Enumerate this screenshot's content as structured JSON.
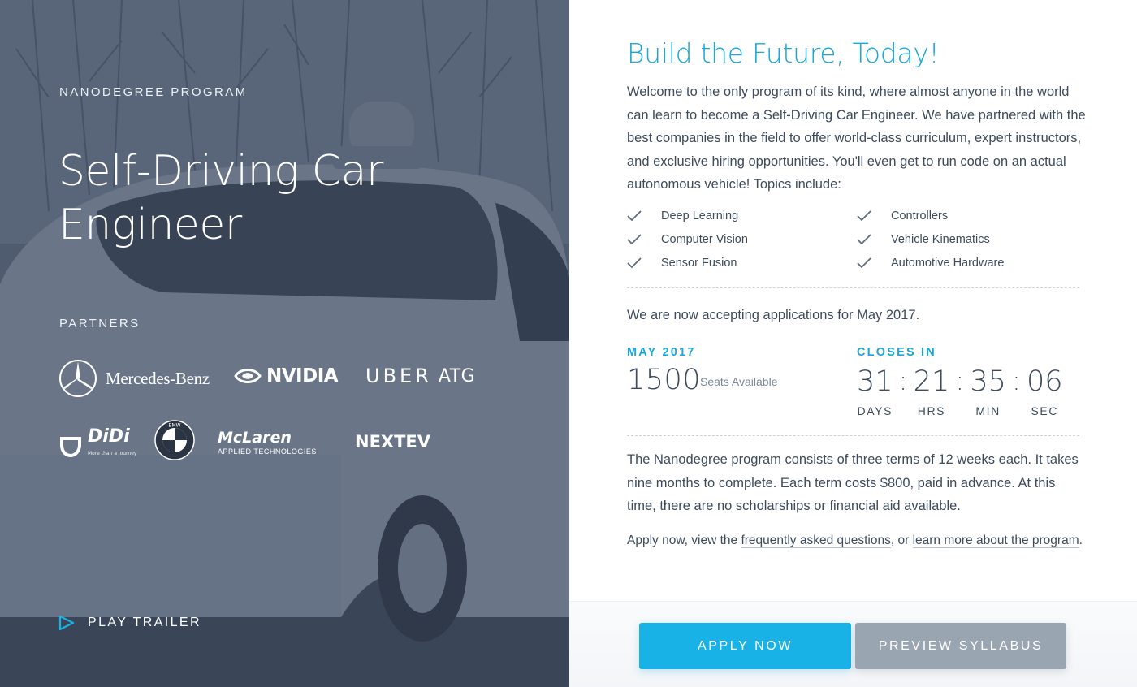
{
  "hero": {
    "eyebrow": "NANODEGREE PROGRAM",
    "title": "Self-Driving Car Engineer",
    "partners_label": "PARTNERS",
    "partners": {
      "mercedes": "Mercedes-Benz",
      "nvidia": "NVIDIA",
      "uber": "UBER",
      "uber_atg": "ATG",
      "didi": "DiDi",
      "didi_tagline": "More than a journey",
      "bmw": "BMW",
      "mclaren": "McLaren",
      "mclaren_sub": "APPLIED TECHNOLOGIES",
      "nextev": "NEXTEV"
    },
    "play_trailer": "PLAY TRAILER"
  },
  "info": {
    "title": "Build the Future, Today!",
    "intro": "Welcome to the only program of its kind, where almost anyone in the world can learn to become a Self-Driving Car Engineer. We have partnered with the best companies in the field to offer world-class curriculum, expert instructors, and exclusive hiring opportunities. You'll even get to run code on an actual autonomous vehicle! Topics include:",
    "topics": [
      "Deep Learning",
      "Controllers",
      "Computer Vision",
      "Vehicle Kinematics",
      "Sensor Fusion",
      "Automotive Hardware"
    ],
    "accepting": "We are now accepting applications for May 2017.",
    "cohort_label": "MAY 2017",
    "seats_count": "1500",
    "seats_label": "Seats Available",
    "closes_label": "CLOSES IN",
    "countdown": {
      "days": "31",
      "days_label": "DAYS",
      "hrs": "21",
      "hrs_label": "HRS",
      "min": "35",
      "min_label": "MIN",
      "sec": "06",
      "sec_label": "SEC",
      "sep": ":"
    },
    "terms": "The Nanodegree program consists of three terms of 12 weeks each. It takes nine months to complete. Each term costs $800, paid in advance. At this time, there are no scholarships or financial aid available.",
    "apply_prefix": "Apply now, view the ",
    "faq_link": "frequently asked questions",
    "apply_mid": ", or ",
    "learn_link": "learn more about the program",
    "apply_suffix": "."
  },
  "buttons": {
    "apply": "APPLY NOW",
    "preview": "PREVIEW SYLLABUS"
  },
  "colors": {
    "accent": "#19a7dd",
    "apply_button": "#19b2e6",
    "preview_button": "#9aa5b2",
    "body_text": "#3d4b5c"
  }
}
